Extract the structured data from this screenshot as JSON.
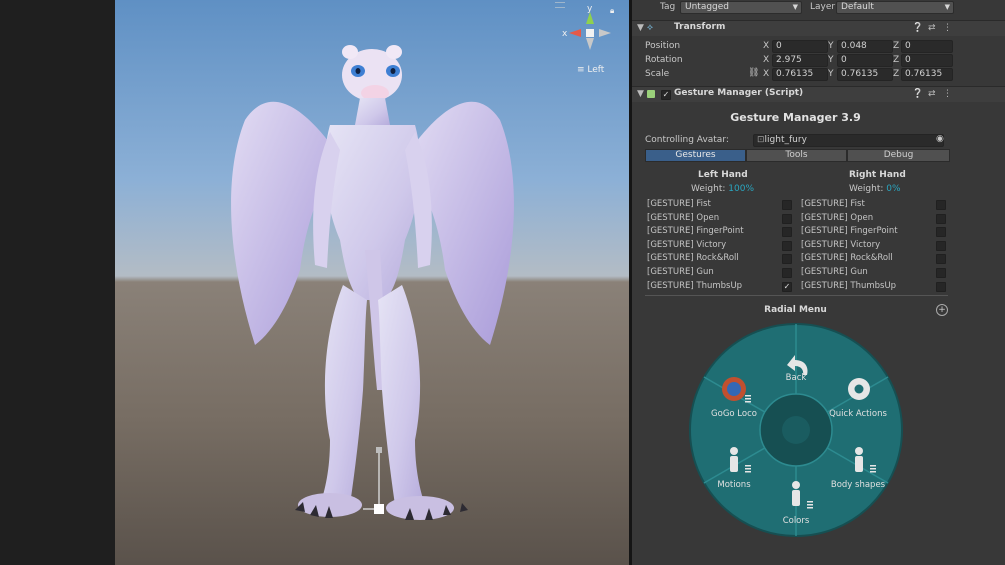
{
  "scene": {
    "orientation_label": "Left",
    "gizmo_axes": {
      "x": "x",
      "y": "y"
    }
  },
  "header": {
    "tag_label": "Tag",
    "tag_value": "Untagged",
    "layer_label": "Layer",
    "layer_value": "Default"
  },
  "transform": {
    "title": "Transform",
    "position": {
      "label": "Position",
      "x": "0",
      "y": "0.048",
      "z": "0"
    },
    "rotation": {
      "label": "Rotation",
      "x": "2.975",
      "y": "0",
      "z": "0"
    },
    "scale": {
      "label": "Scale",
      "x": "0.76135",
      "y": "0.76135",
      "z": "0.76135"
    },
    "axis_labels": {
      "x": "X",
      "y": "Y",
      "z": "Z"
    }
  },
  "gesture_manager": {
    "header_title": "Gesture Manager (Script)",
    "title": "Gesture Manager 3.9",
    "avatar_label": "Controlling Avatar:",
    "avatar_value": "light_fury",
    "tabs": [
      "Gestures",
      "Tools",
      "Debug"
    ],
    "left_hand": {
      "title": "Left Hand",
      "weight_label": "Weight:",
      "weight_value": "100%"
    },
    "right_hand": {
      "title": "Right Hand",
      "weight_label": "Weight:",
      "weight_value": "0%"
    },
    "gestures": [
      "[GESTURE] Fist",
      "[GESTURE] Open",
      "[GESTURE] FingerPoint",
      "[GESTURE] Victory",
      "[GESTURE] Rock&Roll",
      "[GESTURE] Gun",
      "[GESTURE] ThumbsUp"
    ],
    "left_checked": [
      false,
      false,
      false,
      false,
      false,
      false,
      true
    ],
    "right_checked": [
      false,
      false,
      false,
      false,
      false,
      false,
      false
    ],
    "radial_title": "Radial Menu",
    "radial_items": {
      "back": "Back",
      "gogo": "GoGo Loco",
      "quick": "Quick Actions",
      "motions": "Motions",
      "body": "Body shapes",
      "colors": "Colors"
    }
  },
  "colors": {
    "accent": "#3a5f8a",
    "weight": "#2aa6c0",
    "radial": "#1f6e73"
  }
}
